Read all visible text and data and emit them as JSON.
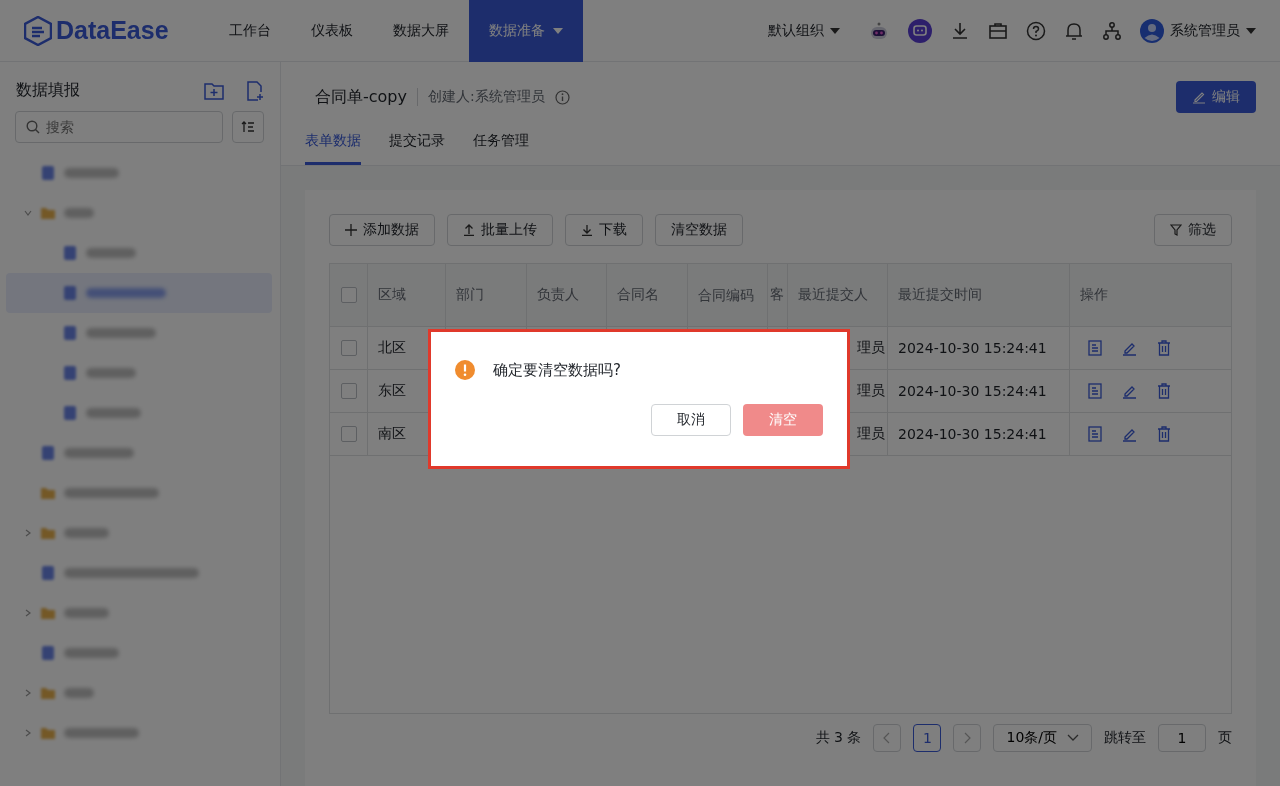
{
  "header": {
    "logo": "DataEase",
    "nav": [
      {
        "label": "工作台",
        "selected": false,
        "dropdown": false
      },
      {
        "label": "仪表板",
        "selected": false,
        "dropdown": false
      },
      {
        "label": "数据大屏",
        "selected": false,
        "dropdown": false
      },
      {
        "label": "数据准备",
        "selected": true,
        "dropdown": true
      }
    ],
    "org": "默认组织",
    "user": "系统管理员"
  },
  "sidebar": {
    "title": "数据填报",
    "search": {
      "placeholder": "搜索"
    },
    "tree": [
      {
        "kind": "file",
        "selected": false
      },
      {
        "kind": "folder",
        "expanded": true,
        "selected": false,
        "children": [
          {
            "kind": "file",
            "selected": false
          },
          {
            "kind": "file",
            "selected": true
          },
          {
            "kind": "file",
            "selected": false
          },
          {
            "kind": "file",
            "selected": false
          },
          {
            "kind": "file",
            "selected": false
          }
        ]
      },
      {
        "kind": "file",
        "selected": false
      },
      {
        "kind": "empty-folder",
        "selected": false
      },
      {
        "kind": "folder",
        "expanded": false,
        "selected": false
      },
      {
        "kind": "file",
        "selected": false
      },
      {
        "kind": "folder",
        "expanded": false,
        "selected": false
      },
      {
        "kind": "file",
        "selected": false
      },
      {
        "kind": "folder",
        "expanded": false,
        "selected": false
      },
      {
        "kind": "folder",
        "expanded": false,
        "selected": false
      }
    ]
  },
  "form": {
    "title": "合同单-copy",
    "creator": "创建人:系统管理员",
    "edit_button": "编辑",
    "tabs": [
      {
        "label": "表单数据",
        "selected": true
      },
      {
        "label": "提交记录",
        "selected": false
      },
      {
        "label": "任务管理",
        "selected": false
      }
    ]
  },
  "toolbar": {
    "buttons": [
      {
        "label": "添加数据",
        "kind": "add"
      },
      {
        "label": "批量上传",
        "kind": "upload"
      },
      {
        "label": "下载",
        "kind": "download"
      },
      {
        "label": "清空数据",
        "kind": "text"
      }
    ],
    "filter": "筛选"
  },
  "table": {
    "all_checked": false,
    "columns": [
      "区域",
      "部门",
      "负责人",
      "合同名",
      "合同编码",
      "客",
      "最近提交人",
      "最近提交时间",
      "操作"
    ],
    "rows": [
      {
        "checked": false,
        "region": "北区",
        "submitter": "理员",
        "time": "2024-10-30 15:24:41"
      },
      {
        "checked": false,
        "region": "东区",
        "submitter": "理员",
        "time": "2024-10-30 15:24:41"
      },
      {
        "checked": false,
        "region": "南区",
        "submitter": "理员",
        "time": "2024-10-30 15:24:41"
      }
    ]
  },
  "pagination": {
    "total": "共 3 条",
    "pages": [
      {
        "label": "1",
        "selected": true
      }
    ],
    "page_size": "10条/页",
    "jump_label": "跳转至",
    "jump_value": "1",
    "page_suffix": "页"
  },
  "dialog": {
    "message": "确定要清空数据吗?",
    "cancel": "取消",
    "confirm": "清空"
  }
}
